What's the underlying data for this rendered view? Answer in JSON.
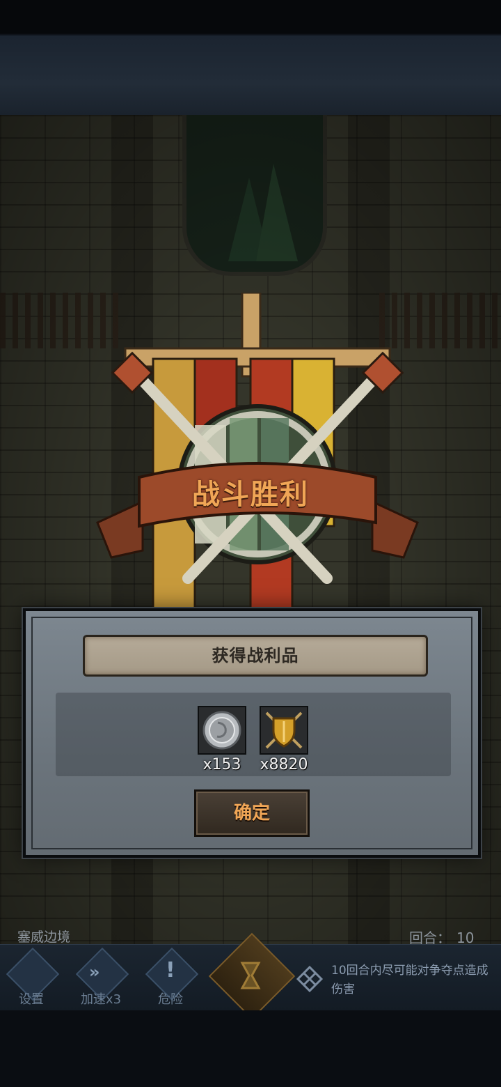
{
  "victory": {
    "title": "战斗胜利"
  },
  "dialog": {
    "loot_title": "获得战利品",
    "items": [
      {
        "icon": "silver-coin-icon",
        "quantity": "x153"
      },
      {
        "icon": "shield-emblem-icon",
        "quantity": "x8820"
      }
    ],
    "confirm_label": "确定"
  },
  "hud": {
    "location": "塞威边境",
    "round_label": "回合：",
    "round_value": "10",
    "buttons": [
      {
        "icon": "gear-icon",
        "label": "设置"
      },
      {
        "icon": "fast-forward-icon",
        "label": "加速x3"
      },
      {
        "icon": "exclamation-icon",
        "label": "危险"
      }
    ],
    "objective": "10回合内尽可能对争夺点造成伤害"
  },
  "colors": {
    "accent": "#f0a656",
    "panel": "#6b747c",
    "banner": "#a59a87"
  }
}
